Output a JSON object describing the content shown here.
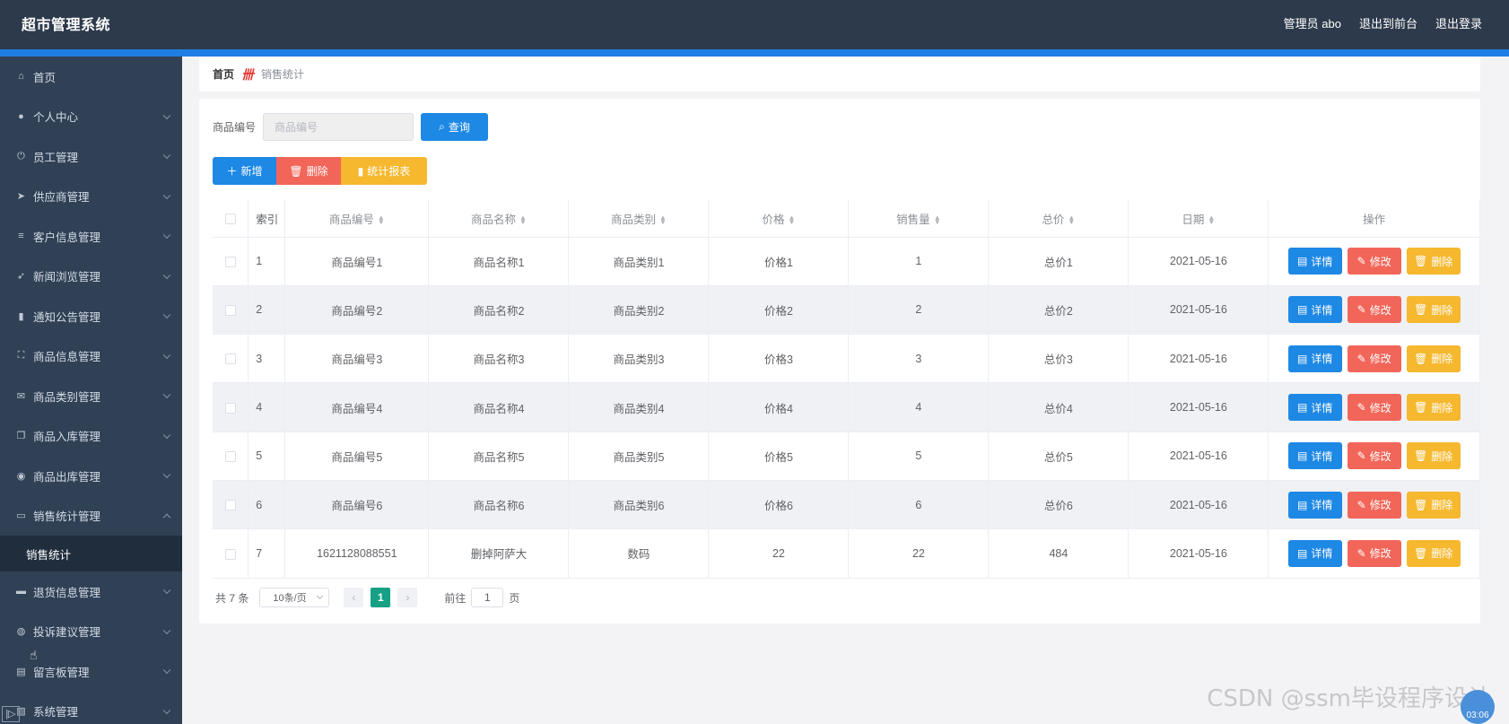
{
  "app": {
    "title": "超市管理系统",
    "user": "管理员 abo",
    "to_front": "退出到前台",
    "logout": "退出登录"
  },
  "sidebar": {
    "items": [
      {
        "label": "首页",
        "icon": "home-icon",
        "chevron": false
      },
      {
        "label": "个人中心",
        "icon": "user-icon",
        "chevron": true
      },
      {
        "label": "员工管理",
        "icon": "power-icon",
        "chevron": true
      },
      {
        "label": "供应商管理",
        "icon": "send-icon",
        "chevron": true
      },
      {
        "label": "客户信息管理",
        "icon": "list-icon",
        "chevron": true
      },
      {
        "label": "新闻浏览管理",
        "icon": "navigation-icon",
        "chevron": true
      },
      {
        "label": "通知公告管理",
        "icon": "bar-chart-icon",
        "chevron": true
      },
      {
        "label": "商品信息管理",
        "icon": "fullscreen-icon",
        "chevron": true
      },
      {
        "label": "商品类别管理",
        "icon": "mail-icon",
        "chevron": true
      },
      {
        "label": "商品入库管理",
        "icon": "copy-icon",
        "chevron": true
      },
      {
        "label": "商品出库管理",
        "icon": "compass-icon",
        "chevron": true
      },
      {
        "label": "销售统计管理",
        "icon": "chat-icon",
        "chevron": true,
        "open": true
      },
      {
        "label": "退货信息管理",
        "icon": "printer-icon",
        "chevron": true
      },
      {
        "label": "投诉建议管理",
        "icon": "globe-icon",
        "chevron": true
      },
      {
        "label": "留言板管理",
        "icon": "briefcase-icon",
        "chevron": true
      },
      {
        "label": "系统管理",
        "icon": "picture-icon",
        "chevron": true
      }
    ],
    "sub_item": "销售统计"
  },
  "breadcrumb": {
    "home": "首页",
    "current": "销售统计"
  },
  "search": {
    "label": "商品编号",
    "placeholder": "商品编号",
    "button": "查询"
  },
  "actions": {
    "add": "新增",
    "delete": "删除",
    "report": "统计报表"
  },
  "table": {
    "headers": [
      "索引",
      "商品编号",
      "商品名称",
      "商品类别",
      "价格",
      "销售量",
      "总价",
      "日期",
      "操作"
    ],
    "rows": [
      [
        "1",
        "商品编号1",
        "商品名称1",
        "商品类别1",
        "价格1",
        "1",
        "总价1",
        "2021-05-16"
      ],
      [
        "2",
        "商品编号2",
        "商品名称2",
        "商品类别2",
        "价格2",
        "2",
        "总价2",
        "2021-05-16"
      ],
      [
        "3",
        "商品编号3",
        "商品名称3",
        "商品类别3",
        "价格3",
        "3",
        "总价3",
        "2021-05-16"
      ],
      [
        "4",
        "商品编号4",
        "商品名称4",
        "商品类别4",
        "价格4",
        "4",
        "总价4",
        "2021-05-16"
      ],
      [
        "5",
        "商品编号5",
        "商品名称5",
        "商品类别5",
        "价格5",
        "5",
        "总价5",
        "2021-05-16"
      ],
      [
        "6",
        "商品编号6",
        "商品名称6",
        "商品类别6",
        "价格6",
        "6",
        "总价6",
        "2021-05-16"
      ],
      [
        "7",
        "1621128088551",
        "删掉阿萨大",
        "数码",
        "22",
        "22",
        "484",
        "2021-05-16"
      ]
    ],
    "row_actions": {
      "detail": "详情",
      "edit": "修改",
      "delete": "删除"
    }
  },
  "pagination": {
    "total": "共 7 条",
    "page_size": "10条/页",
    "current_page": "1",
    "goto_prefix": "前往",
    "goto_value": "1",
    "goto_suffix": "页"
  },
  "overlay": {
    "watermark": "CSDN @ssm毕设程序设计",
    "timer": "03:06"
  },
  "colors": {
    "topbar": "#2d3a4b",
    "sidebar": "#304156",
    "accent": "#1e88e5",
    "danger": "#f2665a",
    "warning": "#f5b82e",
    "page_active": "#16a085"
  }
}
